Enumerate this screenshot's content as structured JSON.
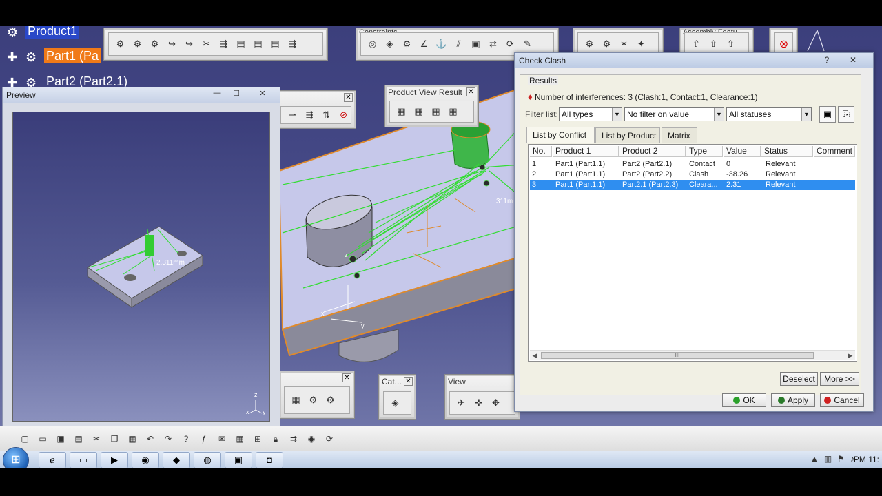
{
  "tree": {
    "product": "Product1",
    "part1": "Part1 (Pa",
    "part2": "Part2 (Part2.1)"
  },
  "preview": {
    "title": "Preview",
    "label": "2.311mm",
    "axis_z": "z",
    "axis_x": "x",
    "axis_y": "y"
  },
  "scene": {
    "label_311": "311m",
    "axis_z": "z",
    "axis_x": "x",
    "axis_y": "y"
  },
  "toolbars": {
    "pvr_title": "Product View Result",
    "cat_title": "Cat...",
    "view_title": "View",
    "constraints_title": "Constraints",
    "assembly_title": "Assembly Featu..."
  },
  "dialog": {
    "title": "Check Clash",
    "help": "?",
    "close": "✕",
    "results_legend": "Results",
    "interferences": "Number of interferences: 3 (Clash:1, Contact:1, Clearance:1)",
    "filter_label": "Filter list:",
    "filter_type": "All types",
    "filter_value": "No filter on value",
    "filter_status": "All statuses",
    "tabs": [
      {
        "label": "List by Conflict"
      },
      {
        "label": "List by Product"
      },
      {
        "label": "Matrix"
      }
    ],
    "columns": [
      "No.",
      "Product 1",
      "Product 2",
      "Type",
      "Value",
      "Status",
      "Comment"
    ],
    "rows": [
      {
        "no": "1",
        "p1": "Part1 (Part1.1)",
        "p2": "Part2 (Part2.1)",
        "type": "Contact",
        "value": "0",
        "status": "Relevant"
      },
      {
        "no": "2",
        "p1": "Part1 (Part1.1)",
        "p2": "Part2 (Part2.2)",
        "type": "Clash",
        "value": "-38.26",
        "status": "Relevant"
      },
      {
        "no": "3",
        "p1": "Part1 (Part1.1)",
        "p2": "Part2.1 (Part2.3)",
        "type": "Cleara...",
        "value": "2.31",
        "status": "Relevant"
      }
    ],
    "scroll_grip": "III",
    "deselect": "Deselect",
    "more": "More >>",
    "ok": "OK",
    "apply": "Apply",
    "cancel": "Cancel"
  },
  "taskbar": {
    "clock": "PM 11:",
    "start": "⊞"
  },
  "colors": {
    "selection_orange": "#f07a18",
    "row_selected": "#2f8ef0",
    "wire_green": "#33dd33"
  }
}
